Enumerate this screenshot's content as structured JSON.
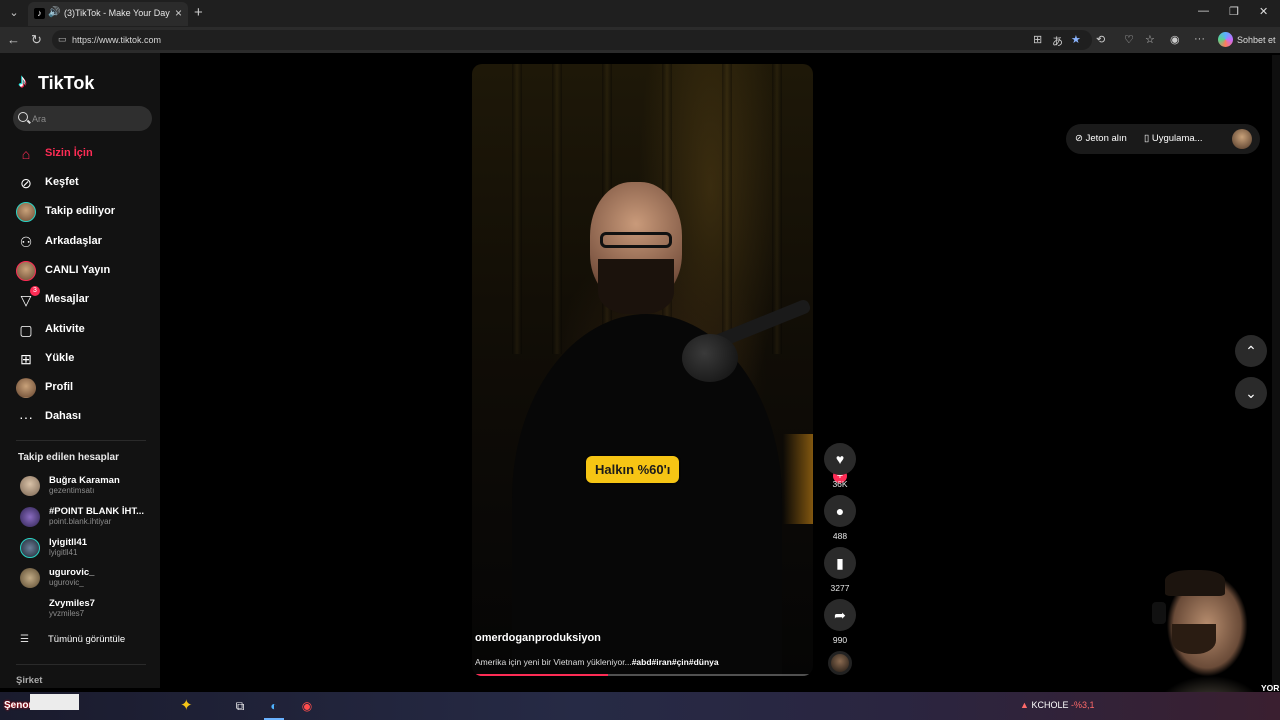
{
  "browser": {
    "tab_title": "(3)TikTok - Make Your Day",
    "url": "https://www.tiktok.com",
    "copilot_label": "Sohbet et"
  },
  "brand": {
    "name": "TikTok"
  },
  "search": {
    "placeholder": "Ara"
  },
  "nav": [
    {
      "label": "Sizin İçin",
      "icon": "home-icon"
    },
    {
      "label": "Keşfet",
      "icon": "compass-icon"
    },
    {
      "label": "Takip ediliyor",
      "icon": "following-avatar-icon"
    },
    {
      "label": "Arkadaşlar",
      "icon": "friends-icon"
    },
    {
      "label": "CANLI Yayın",
      "icon": "live-avatar-icon"
    },
    {
      "label": "Mesajlar",
      "icon": "send-icon",
      "badge": "3"
    },
    {
      "label": "Aktivite",
      "icon": "activity-icon"
    },
    {
      "label": "Yükle",
      "icon": "upload-icon"
    },
    {
      "label": "Profil",
      "icon": "profile-avatar-icon"
    },
    {
      "label": "Dahası",
      "icon": "more-icon"
    }
  ],
  "following": {
    "title": "Takip edilen hesaplar",
    "accounts": [
      {
        "name": "Buğra Karaman",
        "handle": "gezentimsatı"
      },
      {
        "name": "#POINT BLANK İHT...",
        "handle": "point.blank.ihtiyar"
      },
      {
        "name": "lyigitll41",
        "handle": "lyigitll41"
      },
      {
        "name": "ugurovic_",
        "handle": "ugurovic_"
      },
      {
        "name": "Zvymiles7",
        "handle": "yvzmiles7"
      }
    ],
    "see_all": "Tümünü görüntüle"
  },
  "footer": {
    "company": "Şirket"
  },
  "topbar": {
    "coins": "Jeton alın",
    "app": "Uygulama..."
  },
  "video": {
    "caption_overlay": "Halkın %60'ı",
    "author": "omerdoganproduksiyon",
    "description": "Amerika için yeni bir Vietnam yükleniyor...",
    "hashtags": "#abd#iran#çin#dünya",
    "progress": 0.4
  },
  "actions": {
    "likes": "36K",
    "comments": "488",
    "saves": "3277",
    "shares": "990"
  },
  "webcam": {
    "corner_text": "YOR"
  },
  "taskbar": {
    "brand": "Şenor",
    "stock_name": "KCHOLE",
    "stock_change": "-%3,1"
  },
  "colors": {
    "accent": "#fe2c55",
    "caption_bg": "#f6c514",
    "follow_ring": "#2ad3c4"
  }
}
